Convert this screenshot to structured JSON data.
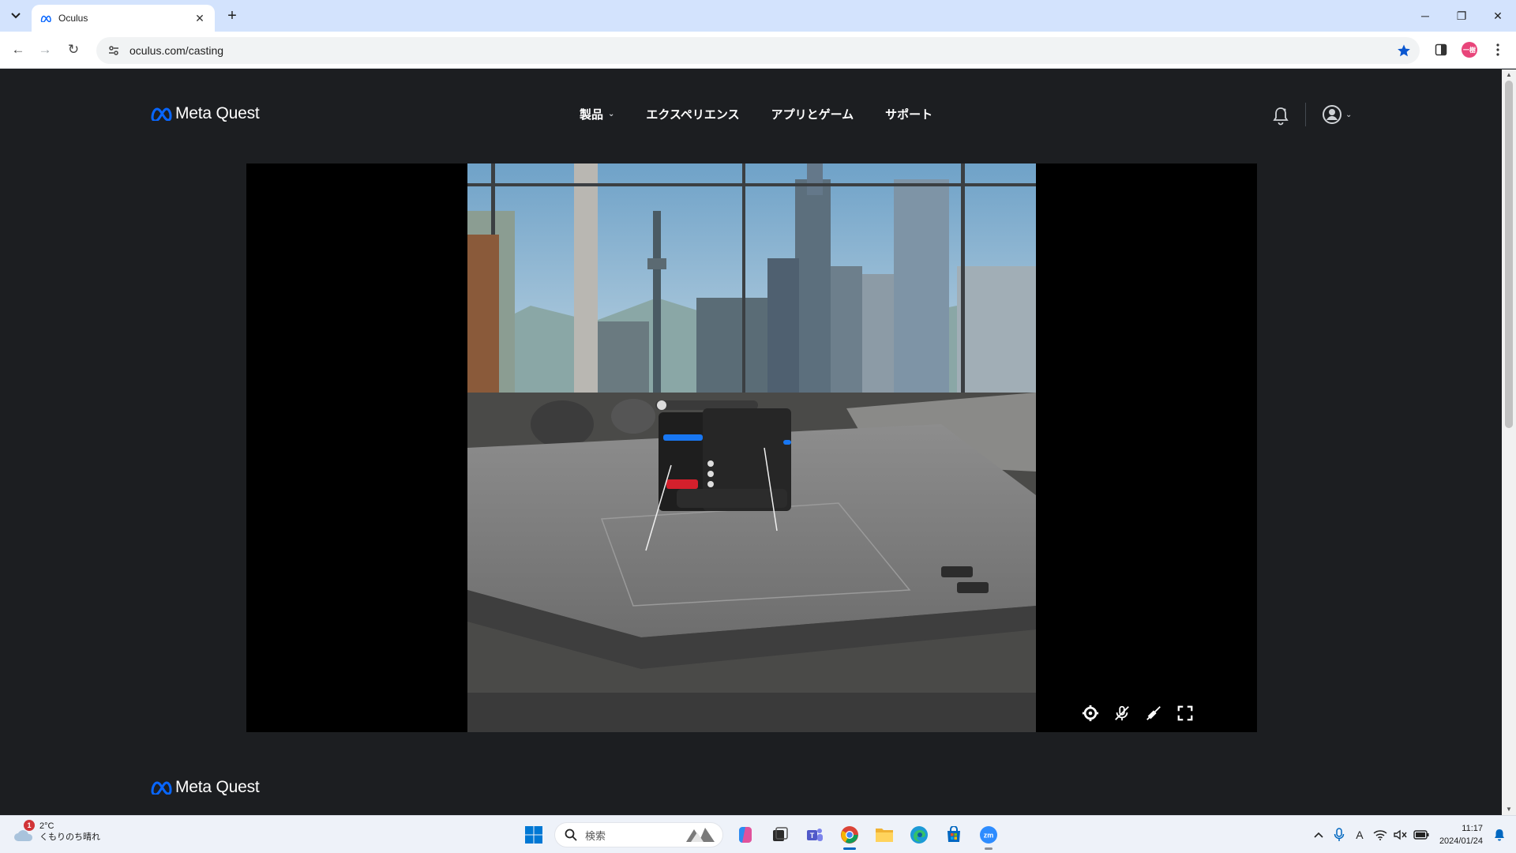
{
  "browser": {
    "tab_title": "Oculus",
    "url": "oculus.com/casting",
    "profile_initials": "一樹"
  },
  "site": {
    "brand": "Meta Quest",
    "nav": [
      "製品",
      "エクスペリエンス",
      "アプリとゲーム",
      "サポート"
    ],
    "accent_color": "#0866ff"
  },
  "cast_controls": [
    "settings-icon",
    "mic-off-icon",
    "audio-off-icon",
    "fullscreen-icon"
  ],
  "taskbar": {
    "weather_temp": "2°C",
    "weather_desc": "くもりのち晴れ",
    "weather_badge": "1",
    "search_placeholder": "検索",
    "time": "11:17",
    "date": "2024/01/24",
    "ime_mode": "A"
  }
}
